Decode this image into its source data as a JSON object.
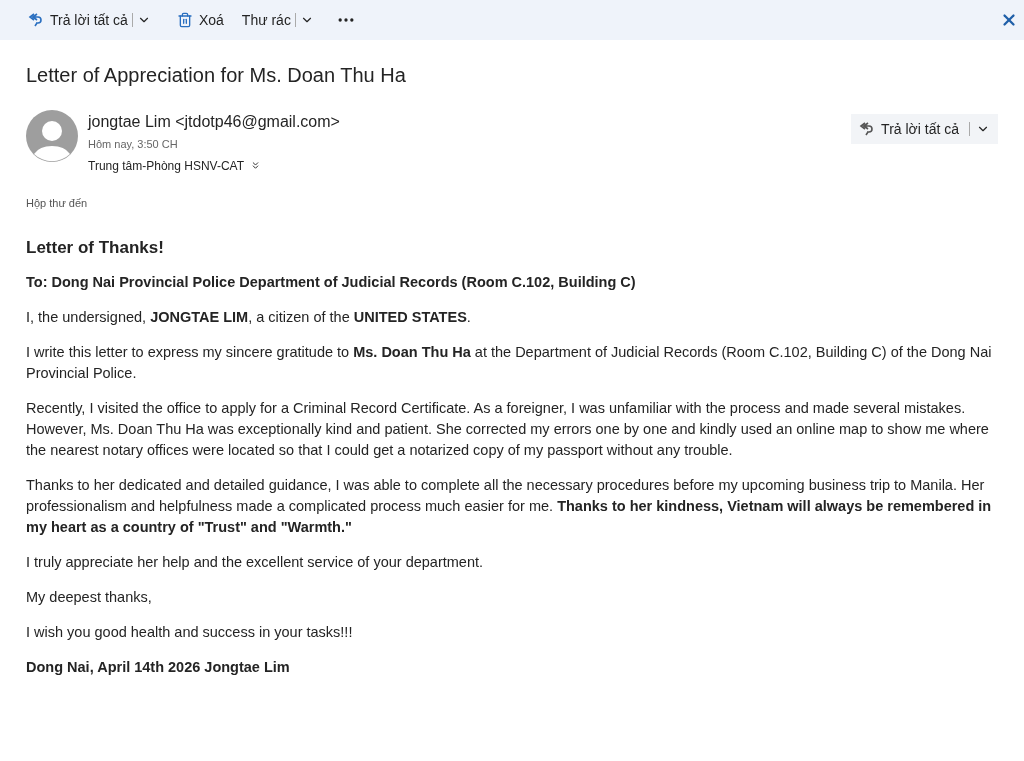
{
  "toolbar": {
    "reply_all": "Trả lời tất cả",
    "delete": "Xoá",
    "junk": "Thư rác"
  },
  "subject": "Letter of Appreciation for Ms. Doan Thu Ha",
  "message": {
    "sender": "jongtae Lim <jtdotp46@gmail.com>",
    "time": "Hôm nay, 3:50 CH",
    "recipient": "Trung tâm-Phòng HSNV-CAT",
    "reply_all": "Trả lời tất cả"
  },
  "folder": "Hộp thư đến",
  "body": [
    {
      "kind": "heading",
      "text": "Letter of Thanks!"
    },
    {
      "kind": "bold",
      "text": "To: Dong Nai Provincial Police Department of Judicial Records (Room C.102, Building C)"
    },
    {
      "kind": "text",
      "text": "I, the undersigned, **JONGTAE LIM**, a citizen of the **UNITED STATES**."
    },
    {
      "kind": "text",
      "text": "I write this letter to express my sincere gratitude to **Ms. Doan Thu Ha** at the Department of Judicial Records (Room C.102, Building C) of the Dong Nai Provincial Police."
    },
    {
      "kind": "text",
      "text": "Recently, I visited the office to apply for a Criminal Record Certificate. As a foreigner, I was unfamiliar with the process and made several mistakes. However, Ms. Doan Thu Ha was exceptionally kind and patient. She corrected my errors one by one and kindly used an online map to show me where the nearest notary offices were located so that I could get a notarized copy of my passport without any trouble."
    },
    {
      "kind": "text",
      "text": "Thanks to her dedicated and detailed guidance, I was able to complete all the necessary procedures before my upcoming business trip to Manila. Her professionalism and helpfulness made a complicated process much easier for me. **Thanks to her kindness, Vietnam will always be remembered in my heart as a country of \"Trust\" and \"Warmth.\"**"
    },
    {
      "kind": "text",
      "text": "I truly appreciate her help and the excellent service of your department."
    },
    {
      "kind": "text",
      "text": "My deepest thanks,"
    },
    {
      "kind": "text",
      "text": "I wish you good health and success in your tasks!!!"
    },
    {
      "kind": "bold",
      "text": "Dong Nai, April 14th 2026 Jongtae Lim"
    }
  ]
}
